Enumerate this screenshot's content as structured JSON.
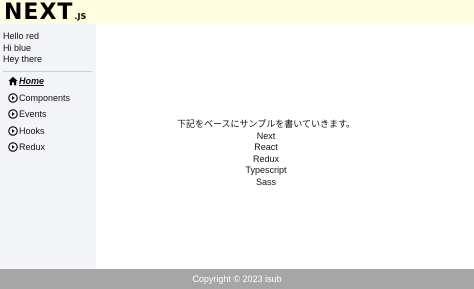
{
  "header": {
    "logo_main": "NEXT",
    "logo_sub": ".JS"
  },
  "sidebar": {
    "greetings": [
      "Hello red",
      "Hi blue",
      "Hey there"
    ],
    "nav": [
      {
        "label": "Home",
        "icon": "home-icon",
        "active": true
      },
      {
        "label": "Components",
        "icon": "play-circle-icon",
        "active": false
      },
      {
        "label": "Events",
        "icon": "play-circle-icon",
        "active": false
      },
      {
        "label": "Hooks",
        "icon": "play-circle-icon",
        "active": false
      },
      {
        "label": "Redux",
        "icon": "play-circle-icon",
        "active": false
      }
    ]
  },
  "main": {
    "intro": "下記をベースにサンプルを書いていきます。",
    "technologies": [
      "Next",
      "React",
      "Redux",
      "Typescript",
      "Sass"
    ]
  },
  "footer": {
    "copyright": "Copyright © 2023 isub"
  }
}
